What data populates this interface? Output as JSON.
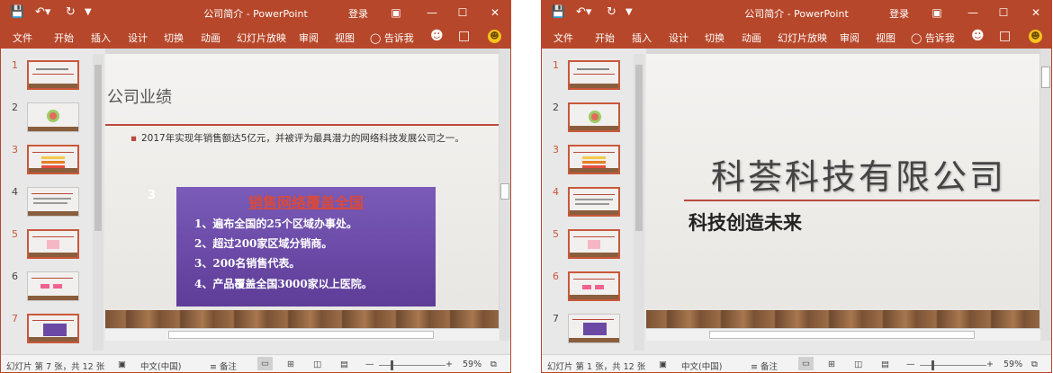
{
  "app": {
    "title": "公司简介  -  PowerPoint",
    "login": "登录",
    "tabs": [
      "文件",
      "开始",
      "插入",
      "设计",
      "切换",
      "动画",
      "幻灯片放映",
      "审阅",
      "视图"
    ],
    "tell_me": "告诉我"
  },
  "left": {
    "thumbnails": [
      "1",
      "2",
      "3",
      "4",
      "5",
      "6",
      "7"
    ],
    "slide": {
      "title": "公司业绩",
      "bullet": "2017年实现年销售额达5亿元，并被评为最具潜力的网络科技发展公司之一。",
      "badge": "3",
      "box_title": "销售网络覆盖全国",
      "items": [
        "1、遍布全国的25个区域办事处。",
        "2、超过200家区域分销商。",
        "3、200名销售代表。",
        "4、产品覆盖全国3000家以上医院。"
      ]
    },
    "status": {
      "slide_info": "幻灯片 第 7 张，共 12 张",
      "language": "中文(中国)",
      "notes": "备注",
      "zoom": "59%"
    }
  },
  "right": {
    "thumbnails": [
      "1",
      "2",
      "3",
      "4",
      "5",
      "6",
      "7"
    ],
    "slide": {
      "title": "科荟科技有限公司",
      "subtitle": "科技创造未来"
    },
    "status": {
      "slide_info": "幻灯片 第 1 张，共 12 张",
      "language": "中文(中国)",
      "notes": "备注",
      "zoom": "59%"
    }
  },
  "colors": {
    "accent": "#b7472a",
    "box": "#6a48a4",
    "box_title": "#d84a3a"
  }
}
